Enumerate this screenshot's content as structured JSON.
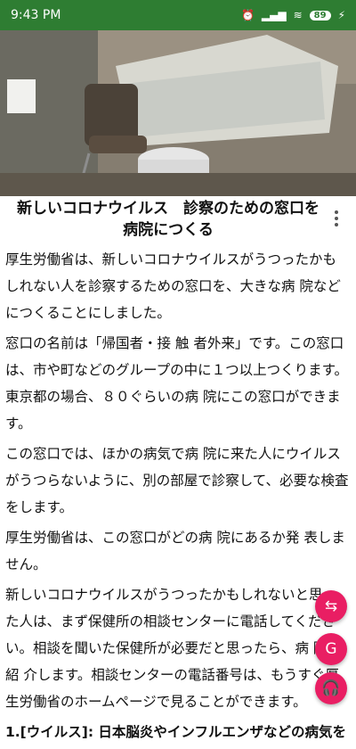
{
  "status": {
    "time": "9:43 PM",
    "battery": "89"
  },
  "article": {
    "title": "新しいコロナウイルス　診察のための窓口を病院につくる",
    "p1": "厚生労働省は、新しいコロナウイルスがうつったかもしれない人を診察するための窓口を、大きな病 院などにつくることにしました。",
    "p2": "窓口の名前は「帰国者・接 触 者外来」です。この窓口は、市や町などのグループの中に１つ以上つくります。東京都の場合、８０ぐらいの病 院にこの窓口ができます。",
    "p3": "この窓口では、ほかの病気で病 院に来た人にウイルスがうつらないように、別の部屋で診察して、必要な検査をします。",
    "p4": "厚生労働省は、この窓口がどの病 院にあるか発 表しません。",
    "p5": "新しいコロナウイルスがうつったかもしれないと思った人は、まず保健所の相談センターに電話してください。相談を聞いた保健所が必要だと思ったら、病 院を紹 介します。相談センターの電話番号は、もうすぐ厚生労働省のホームページで見ることができます。",
    "footnote": "1.[ウイルス]: 日本脳炎やインフルエンザなどの病気を"
  },
  "icons": {
    "menu": "more-vert-icon",
    "swap": "swap-icon",
    "translate": "translate-icon",
    "audio": "headphones-icon"
  },
  "colors": {
    "status_bar": "#2e7d32",
    "highlight": "#e06a45",
    "furigana": "#c0392b",
    "fab": "#e91e63"
  }
}
